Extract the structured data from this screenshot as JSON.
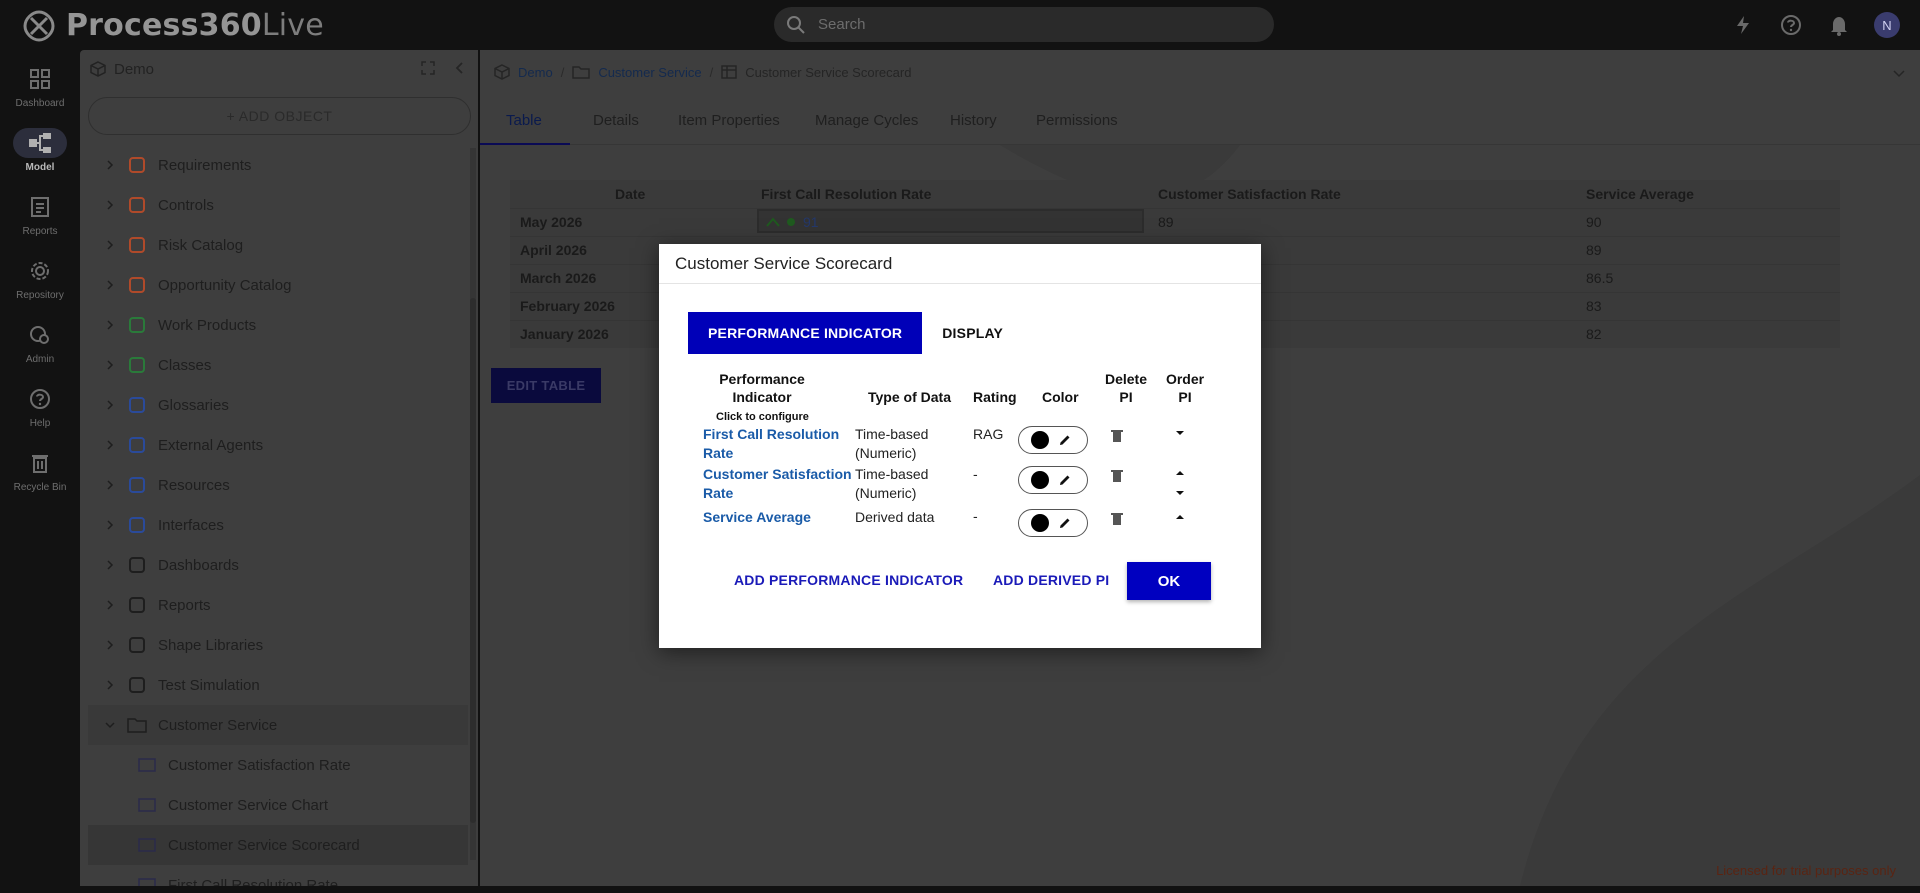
{
  "app": {
    "logo_bold": "Process360",
    "logo_light": "Live",
    "search_placeholder": "Search",
    "user_initial": "N"
  },
  "rail": [
    {
      "label": "Dashboard",
      "icon": "dashboard-icon"
    },
    {
      "label": "Model",
      "icon": "model-icon",
      "active": true
    },
    {
      "label": "Reports",
      "icon": "reports-icon"
    },
    {
      "label": "Repository",
      "icon": "repository-icon"
    },
    {
      "label": "Admin",
      "icon": "admin-icon"
    },
    {
      "label": "Help",
      "icon": "help-icon"
    },
    {
      "label": "Recycle Bin",
      "icon": "recycle-bin-icon"
    }
  ],
  "tree": {
    "title": "Demo",
    "add_object": "+ ADD OBJECT",
    "items": [
      {
        "label": "Requirements",
        "icon": "requirements-icon",
        "color": "#b04a2a"
      },
      {
        "label": "Controls",
        "icon": "controls-icon",
        "color": "#b04a2a"
      },
      {
        "label": "Risk Catalog",
        "icon": "risk-icon",
        "color": "#b04a2a"
      },
      {
        "label": "Opportunity Catalog",
        "icon": "bulb-icon",
        "color": "#b04a2a"
      },
      {
        "label": "Work Products",
        "icon": "work-products-icon",
        "color": "#2a7a3a"
      },
      {
        "label": "Classes",
        "icon": "classes-icon",
        "color": "#2a7a3a"
      },
      {
        "label": "Glossaries",
        "icon": "glossary-icon",
        "color": "#2a4a9a"
      },
      {
        "label": "External Agents",
        "icon": "external-agent-icon",
        "color": "#2a4a9a"
      },
      {
        "label": "Resources",
        "icon": "resources-icon",
        "color": "#2a4a9a"
      },
      {
        "label": "Interfaces",
        "icon": "interfaces-icon",
        "color": "#2a4a9a"
      },
      {
        "label": "Dashboards",
        "icon": "dashboards-icon",
        "color": "#1e1e1e"
      },
      {
        "label": "Reports",
        "icon": "report-icon",
        "color": "#1e1e1e"
      },
      {
        "label": "Shape Libraries",
        "icon": "shape-library-icon",
        "color": "#1e1e1e"
      },
      {
        "label": "Test Simulation",
        "icon": "simulation-icon",
        "color": "#1e1e1e"
      },
      {
        "label": "Customer Service",
        "icon": "folder-icon",
        "color": "#1e1e1e",
        "open": true
      }
    ],
    "children": [
      {
        "label": "Customer Satisfaction Rate",
        "icon": "gauge-icon"
      },
      {
        "label": "Customer Service Chart",
        "icon": "chart-icon"
      },
      {
        "label": "Customer Service Scorecard",
        "icon": "table-icon",
        "selected": true
      },
      {
        "label": "First Call Resolution Rate",
        "icon": "gauge-icon"
      }
    ]
  },
  "breadcrumb": {
    "root": "Demo",
    "folder": "Customer Service",
    "current": "Customer Service Scorecard"
  },
  "tabs": [
    "Table",
    "Details",
    "Item Properties",
    "Manage Cycles",
    "History",
    "Permissions"
  ],
  "grid": {
    "headers": [
      "Date",
      "First Call Resolution Rate",
      "Customer Satisfaction Rate",
      "Service Average"
    ],
    "rows": [
      {
        "date": "May 2026",
        "fcr": "91",
        "csr": "89",
        "avg": "90"
      },
      {
        "date": "April 2026",
        "fcr": "",
        "csr": "",
        "avg": "89"
      },
      {
        "date": "March 2026",
        "fcr": "",
        "csr": "",
        "avg": "86.5"
      },
      {
        "date": "February 2026",
        "fcr": "",
        "csr": "",
        "avg": "83"
      },
      {
        "date": "January 2026",
        "fcr": "",
        "csr": "",
        "avg": "82"
      }
    ],
    "edit_button": "EDIT TABLE"
  },
  "trial_notice": "Licensed for trial purposes only",
  "modal": {
    "title": "Customer Service Scorecard",
    "tabs": [
      "PERFORMANCE INDICATOR",
      "DISPLAY"
    ],
    "headers": {
      "pi_line1": "Performance",
      "pi_line2": "Indicator",
      "pi_sub": "Click to configure",
      "type": "Type of Data",
      "rating": "Rating",
      "color": "Color",
      "delete_line1": "Delete",
      "delete_line2": "PI",
      "order_line1": "Order",
      "order_line2": "PI"
    },
    "rows": [
      {
        "name_line1": "First Call Resolution",
        "name_line2": "Rate",
        "type_line1": "Time-based",
        "type_line2": "(Numeric)",
        "rating": "RAG",
        "color": "#000000"
      },
      {
        "name_line1": "Customer Satisfaction",
        "name_line2": "Rate",
        "type_line1": "Time-based",
        "type_line2": "(Numeric)",
        "rating": "-",
        "color": "#000000"
      },
      {
        "name_line1": "Service Average",
        "name_line2": "",
        "type_line1": "Derived data",
        "type_line2": "",
        "rating": "-",
        "color": "#000000"
      }
    ],
    "add_pi": "ADD PERFORMANCE INDICATOR",
    "add_derived": "ADD DERIVED PI",
    "ok": "OK"
  }
}
